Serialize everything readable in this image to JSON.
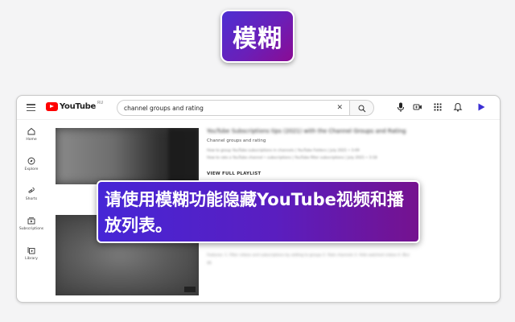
{
  "badge": {
    "label": "模糊"
  },
  "youtube": {
    "logo_text": "YouTube",
    "logo_region": "RU",
    "search_query": "channel groups and rating",
    "sidebar": [
      {
        "label": "Home",
        "icon": "home-icon"
      },
      {
        "label": "Explore",
        "icon": "compass-icon"
      },
      {
        "label": "Shorts",
        "icon": "shorts-icon"
      },
      {
        "label": "Subscriptions",
        "icon": "subscriptions-icon"
      },
      {
        "label": "Library",
        "icon": "library-icon"
      }
    ],
    "result1": {
      "title": "YouTube Subscriptions tips (2021) with the Channel Groups and Rating",
      "channel": "Channel groups and rating",
      "line1": "How to group YouTube subscriptions in channels | YouTube Folders | July 2021 • 3:49",
      "line2": "How to rate a YouTube channel • subscriptions | YouTube filter subscriptions | July 2021 • 3:18",
      "view_all": "VIEW FULL PLAYLIST"
    },
    "result2": {
      "desc_line1": "Features: 1. Filter videos and subscriptions by adding to groups 2. Rate channels 3. Hide watched videos 4. Blur",
      "desc_line2": "4K"
    }
  },
  "callout": {
    "text": "请使用模糊功能隐藏YouTube视频和播放列表。"
  }
}
